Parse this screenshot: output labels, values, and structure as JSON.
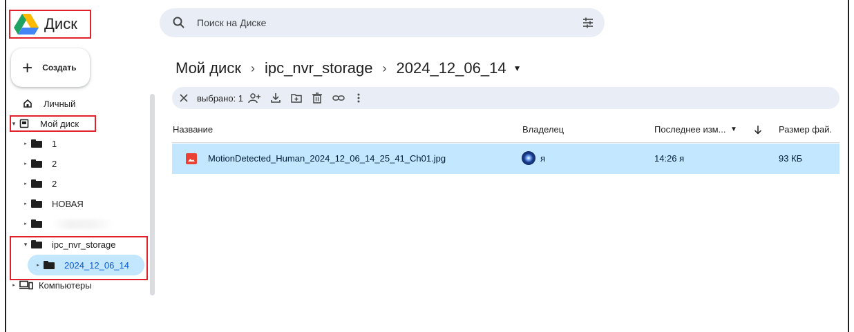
{
  "app": {
    "title": "Диск",
    "brand_colors": [
      "#1ea362",
      "#ffba00",
      "#4285f4"
    ]
  },
  "search": {
    "placeholder": "Поиск на Диске",
    "value": ""
  },
  "create_button": {
    "label": "Создать"
  },
  "sidebar": {
    "items": [
      {
        "label": "Личный",
        "icon": "home-icon"
      },
      {
        "label": "Мой диск",
        "icon": "drive-icon",
        "expanded": true
      },
      {
        "label": "1",
        "icon": "folder-icon"
      },
      {
        "label": "2",
        "icon": "folder-icon"
      },
      {
        "label": "2",
        "icon": "folder-icon"
      },
      {
        "label": "НОВАЯ",
        "icon": "folder-icon"
      },
      {
        "label": "",
        "icon": "folder-icon"
      },
      {
        "label": "ipc_nvr_storage",
        "icon": "folder-icon",
        "expanded": true
      },
      {
        "label": "2024_12_06_14",
        "icon": "folder-icon",
        "selected": true
      },
      {
        "label": "Компьютеры",
        "icon": "computers-icon"
      }
    ]
  },
  "breadcrumb": {
    "items": [
      "Мой диск",
      "ipc_nvr_storage",
      "2024_12_06_14"
    ]
  },
  "actionbar": {
    "selected_label": "выбрано: 1"
  },
  "table": {
    "columns": [
      "Название",
      "Владелец",
      "Последнее изм...",
      "Размер фай."
    ],
    "rows": [
      {
        "name": "MotionDetected_Human_2024_12_06_14_25_41_Ch01.jpg",
        "owner": "я",
        "modified": "14:26 я",
        "size": "93 КБ",
        "selected": true
      }
    ]
  },
  "colors": {
    "highlight_box": "#e0202a",
    "selection": "#c2e7ff",
    "search_bg": "#e9eef6"
  }
}
